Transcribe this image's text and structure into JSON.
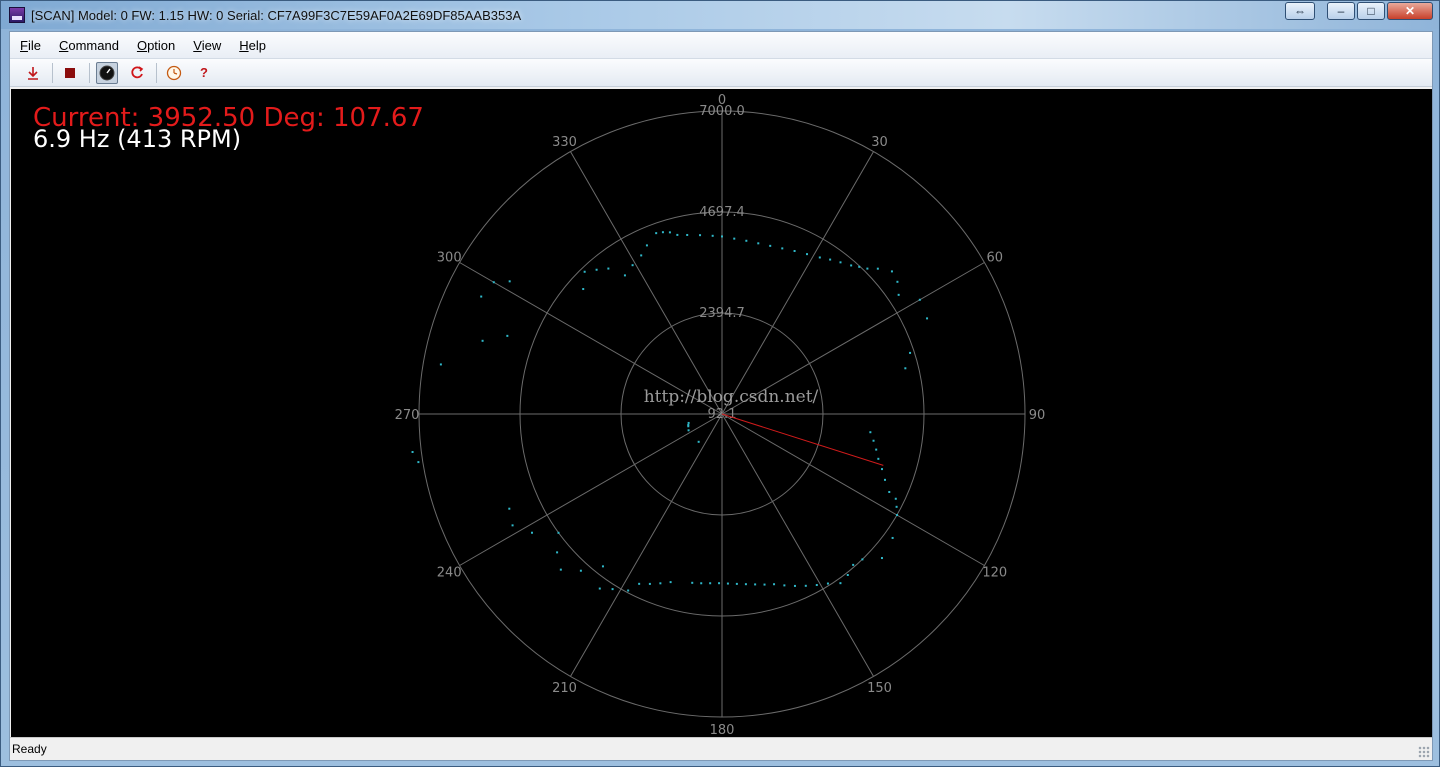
{
  "window": {
    "title": "[SCAN] Model: 0 FW: 1.15 HW: 0 Serial: CF7A99F3C7E59AF0A2E69DF85AAB353A",
    "buttons": {
      "extra": "⇔",
      "minimize": "–",
      "maximize": "□",
      "close": "✕"
    }
  },
  "menu": [
    {
      "key": "F",
      "rest": "ile"
    },
    {
      "key": "C",
      "rest": "ommand"
    },
    {
      "key": "O",
      "rest": "ption"
    },
    {
      "key": "V",
      "rest": "iew"
    },
    {
      "key": "H",
      "rest": "elp"
    }
  ],
  "toolbar": {
    "icons": [
      "download-icon",
      "stop-icon",
      "gauge-icon",
      "refresh-icon",
      "clock-icon",
      "help-icon"
    ],
    "help_glyph": "?"
  },
  "overlay": {
    "current": "Current: 3952.50 Deg: 107.67",
    "frequency": "6.9 Hz (413 RPM)"
  },
  "watermark": "http://blog.csdn.net/",
  "status": "Ready",
  "colors": {
    "current": "#e31b1b",
    "points": "#2fb8c9",
    "grid": "#6b6b6b",
    "labels": "#8a8a8a",
    "needle": "#d01b1b"
  },
  "chart_data": {
    "type": "scatter",
    "projection": "polar",
    "angle_direction": "clockwise",
    "angle_zero": "top",
    "angle_labels": [
      "0",
      "30",
      "60",
      "90",
      "120",
      "150",
      "180",
      "210",
      "240",
      "270",
      "300",
      "330"
    ],
    "radius_labels": [
      "92.1",
      "2394.7",
      "4697.4",
      "7000.0"
    ],
    "radius_range": [
      92.1,
      7000.0
    ],
    "current": {
      "angle_deg": 107.67,
      "distance": 3952.5
    },
    "points": [
      [
        -14,
        4300
      ],
      [
        -11,
        4250
      ],
      [
        -7,
        4200
      ],
      [
        -3,
        4160
      ],
      [
        0,
        4140
      ],
      [
        4,
        4100
      ],
      [
        8,
        4080
      ],
      [
        12,
        4070
      ],
      [
        16,
        4080
      ],
      [
        20,
        4110
      ],
      [
        24,
        4160
      ],
      [
        28,
        4220
      ],
      [
        32,
        4300
      ],
      [
        35,
        4390
      ],
      [
        38,
        4480
      ],
      [
        41,
        4580
      ],
      [
        43,
        4680
      ],
      [
        45,
        4780
      ],
      [
        -16,
        4400
      ],
      [
        -18,
        4450
      ],
      [
        -20,
        4480
      ],
      [
        -24,
        4300
      ],
      [
        -27,
        4150
      ],
      [
        -31,
        4050
      ],
      [
        -35,
        3950
      ],
      [
        -38,
        4300
      ],
      [
        -41,
        4450
      ],
      [
        -44,
        4600
      ],
      [
        -48,
        4350
      ],
      [
        -58,
        5800
      ],
      [
        -60,
        6100
      ],
      [
        -64,
        6200
      ],
      [
        -70,
        5300
      ],
      [
        -73,
        5800
      ],
      [
        -80,
        6600
      ],
      [
        -97,
        7200
      ],
      [
        -99,
        7100
      ],
      [
        47,
        4950
      ],
      [
        50,
        5150
      ],
      [
        53,
        5100
      ],
      [
        56,
        4950
      ],
      [
        60,
        5300
      ],
      [
        65,
        5250
      ],
      [
        72,
        4600
      ],
      [
        76,
        4400
      ],
      [
        97,
        3500
      ],
      [
        100,
        3600
      ],
      [
        103,
        3700
      ],
      [
        106,
        3800
      ],
      [
        109,
        3950
      ],
      [
        112,
        4100
      ],
      [
        115,
        4300
      ],
      [
        116,
        4500
      ],
      [
        118,
        4600
      ],
      [
        120,
        4700
      ],
      [
        126,
        4900
      ],
      [
        132,
        5000
      ],
      [
        136,
        4700
      ],
      [
        139,
        4650
      ],
      [
        142,
        4750
      ],
      [
        145,
        4800
      ],
      [
        148,
        4650
      ],
      [
        151,
        4550
      ],
      [
        154,
        4450
      ],
      [
        157,
        4350
      ],
      [
        160,
        4250
      ],
      [
        163,
        4150
      ],
      [
        166,
        4100
      ],
      [
        169,
        4050
      ],
      [
        172,
        4010
      ],
      [
        175,
        3980
      ],
      [
        178,
        3960
      ],
      [
        181,
        3950
      ],
      [
        184,
        3960
      ],
      [
        187,
        3980
      ],
      [
        190,
        4000
      ],
      [
        197,
        4100
      ],
      [
        200,
        4200
      ],
      [
        203,
        4300
      ],
      [
        206,
        4400
      ],
      [
        208,
        4650
      ],
      [
        212,
        4800
      ],
      [
        215,
        4950
      ],
      [
        218,
        4500
      ],
      [
        222,
        4900
      ],
      [
        226,
        5200
      ],
      [
        230,
        5000
      ],
      [
        234,
        4700
      ],
      [
        238,
        5200
      ],
      [
        242,
        5500
      ],
      [
        246,
        5400
      ],
      [
        -105,
        880
      ],
      [
        -108,
        900
      ],
      [
        -110,
        910
      ],
      [
        -116,
        940
      ],
      [
        -140,
        920
      ]
    ]
  }
}
